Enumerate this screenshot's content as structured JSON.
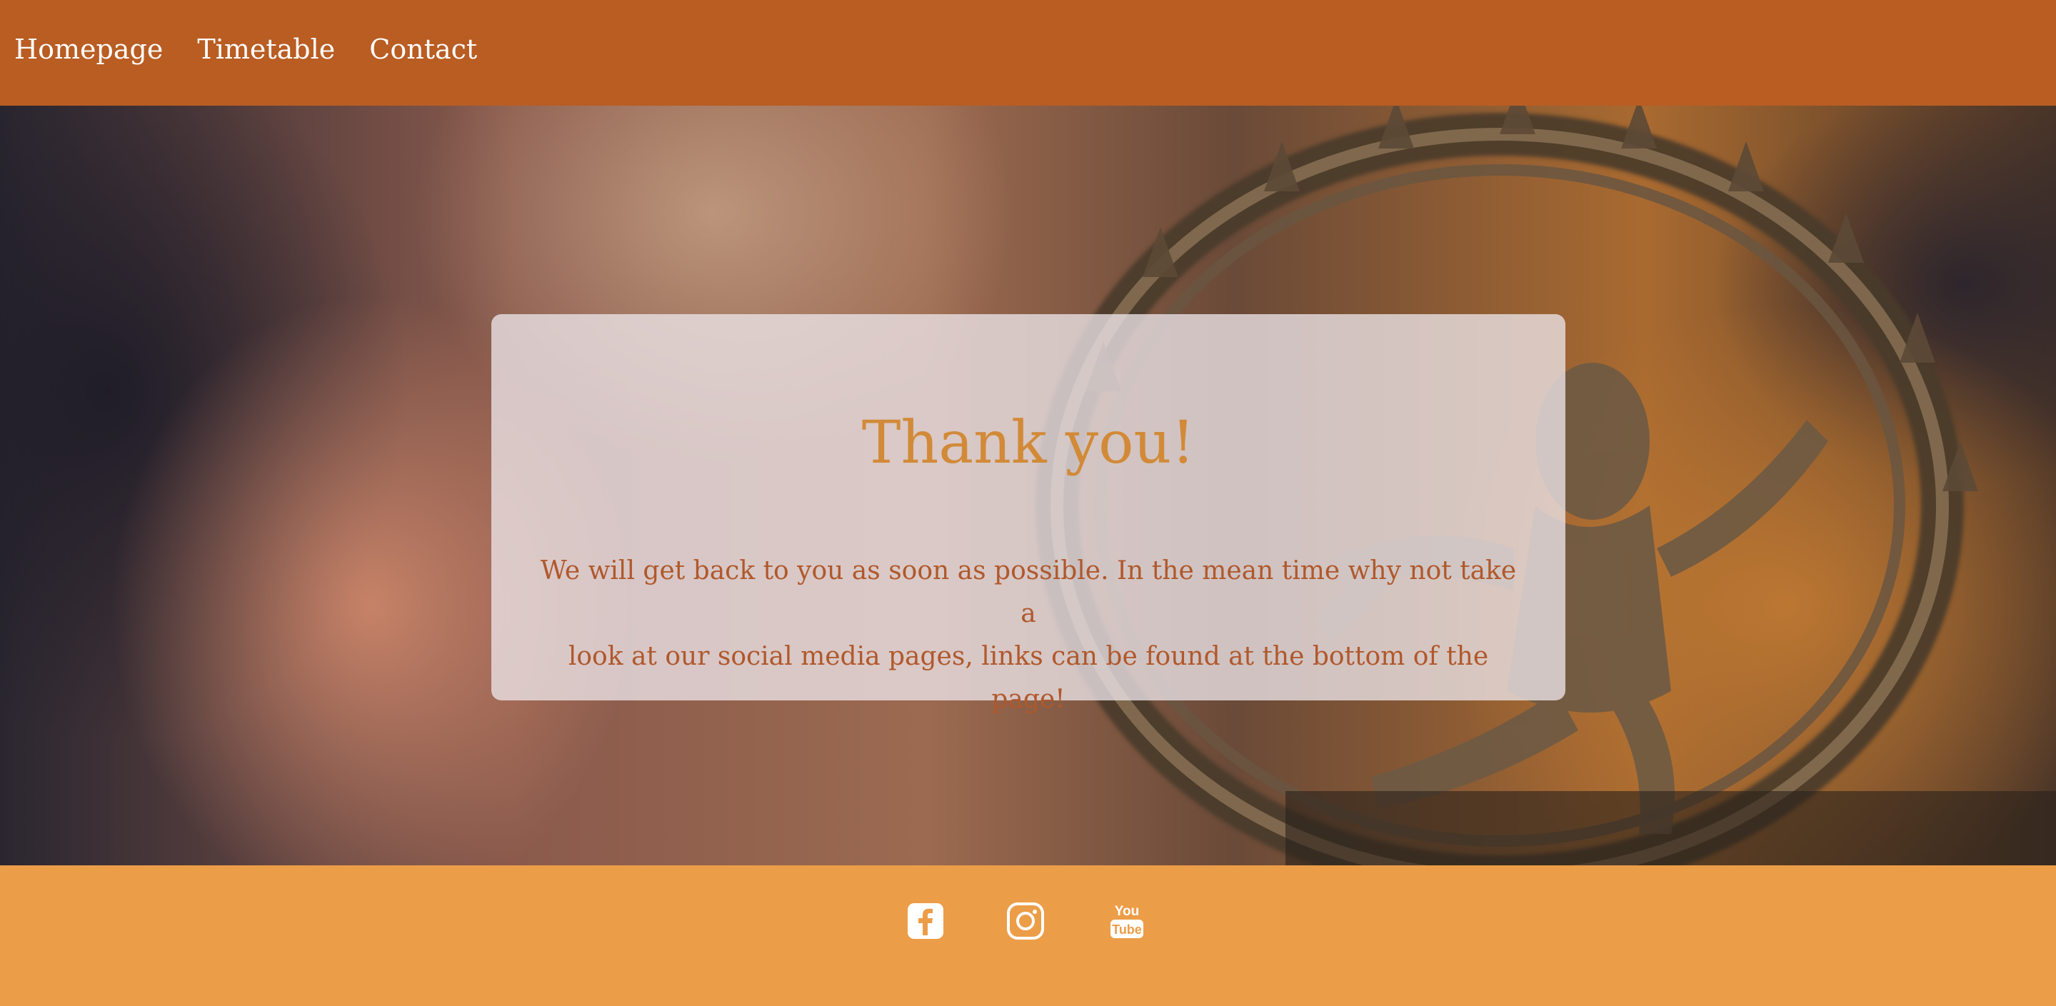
{
  "nav": {
    "items": [
      {
        "label": "Homepage"
      },
      {
        "label": "Timetable"
      },
      {
        "label": "Contact"
      }
    ]
  },
  "card": {
    "title": "Thank you!",
    "message_line1": "We will get back to you as soon as possible. In the mean time why not take a",
    "message_line2": "look at our social media pages, links can be found at the bottom of the page!"
  },
  "footer": {
    "social": [
      {
        "icon": "facebook-icon"
      },
      {
        "icon": "instagram-icon"
      },
      {
        "icon": "youtube-icon",
        "text_top": "You",
        "text_bottom": "Tube"
      }
    ]
  },
  "colors": {
    "nav_bg": "#b95d23",
    "footer_bg": "#ec9d48",
    "title": "#d28a38",
    "body_text": "#b0582c"
  }
}
